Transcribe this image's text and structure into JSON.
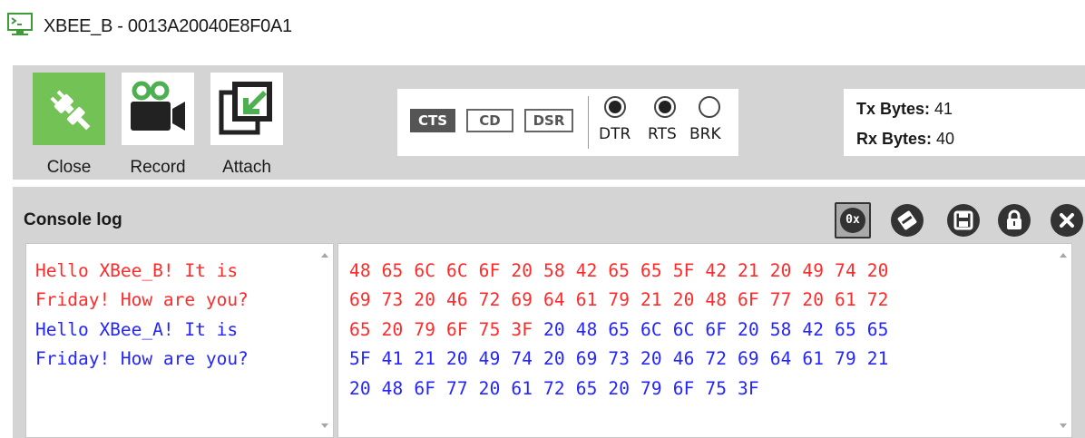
{
  "window": {
    "title": "XBEE_B - 0013A20040E8F0A1",
    "icon": "terminal-icon",
    "accent_color": "#3f9b3a"
  },
  "toolbar": {
    "close_label": "Close",
    "close_icon": "plug-icon",
    "close_color": "#72c255",
    "record_label": "Record",
    "record_icon": "video-camera-icon",
    "attach_label": "Attach",
    "attach_icon": "attach-icon",
    "signals": {
      "cts": {
        "label": "CTS",
        "active": true
      },
      "cd": {
        "label": "CD",
        "active": false
      },
      "dsr": {
        "label": "DSR",
        "active": false
      },
      "dtr": {
        "label": "DTR",
        "checked": true
      },
      "rts": {
        "label": "RTS",
        "checked": true
      },
      "brk": {
        "label": "BRK",
        "checked": false
      }
    },
    "bytes": {
      "tx_label": "Tx Bytes:",
      "tx_value": "41",
      "rx_label": "Rx Bytes:",
      "rx_value": "40"
    }
  },
  "console": {
    "title": "Console log",
    "buttons": {
      "hex_label": "0x",
      "hex_icon": "hex-toggle-icon",
      "clear_icon": "clear-icon",
      "save_icon": "save-icon",
      "lock_icon": "lock-icon",
      "close_icon": "close-icon"
    },
    "colors": {
      "sent": "#ff2a2a",
      "received": "#2424ff"
    },
    "ascii_lines": [
      [
        {
          "text": "Hello XBee_B! It is",
          "dir": "sent"
        }
      ],
      [
        {
          "text": "Friday! How are you?",
          "dir": "sent"
        }
      ],
      [
        {
          "text": "Hello XBee_A! It is",
          "dir": "received"
        }
      ],
      [
        {
          "text": "Friday! How are you?",
          "dir": "received"
        }
      ]
    ],
    "hex_lines": [
      [
        {
          "text": "48 65 6C 6C 6F 20 58 42 65 65 5F 42 21 20 49 74 20",
          "dir": "sent"
        }
      ],
      [
        {
          "text": "69 73 20 46 72 69 64 61 79 21 20 48 6F 77 20 61 72",
          "dir": "sent"
        }
      ],
      [
        {
          "text": "65 20 79 6F 75 3F ",
          "dir": "sent"
        },
        {
          "text": "20 48 65 6C 6C 6F 20 58 42 65 65",
          "dir": "received"
        }
      ],
      [
        {
          "text": "5F 41 21 20 49 74 20 69 73 20 46 72 69 64 61 79 21",
          "dir": "received"
        }
      ],
      [
        {
          "text": "20 48 6F 77 20 61 72 65 20 79 6F 75 3F",
          "dir": "received"
        }
      ]
    ]
  }
}
